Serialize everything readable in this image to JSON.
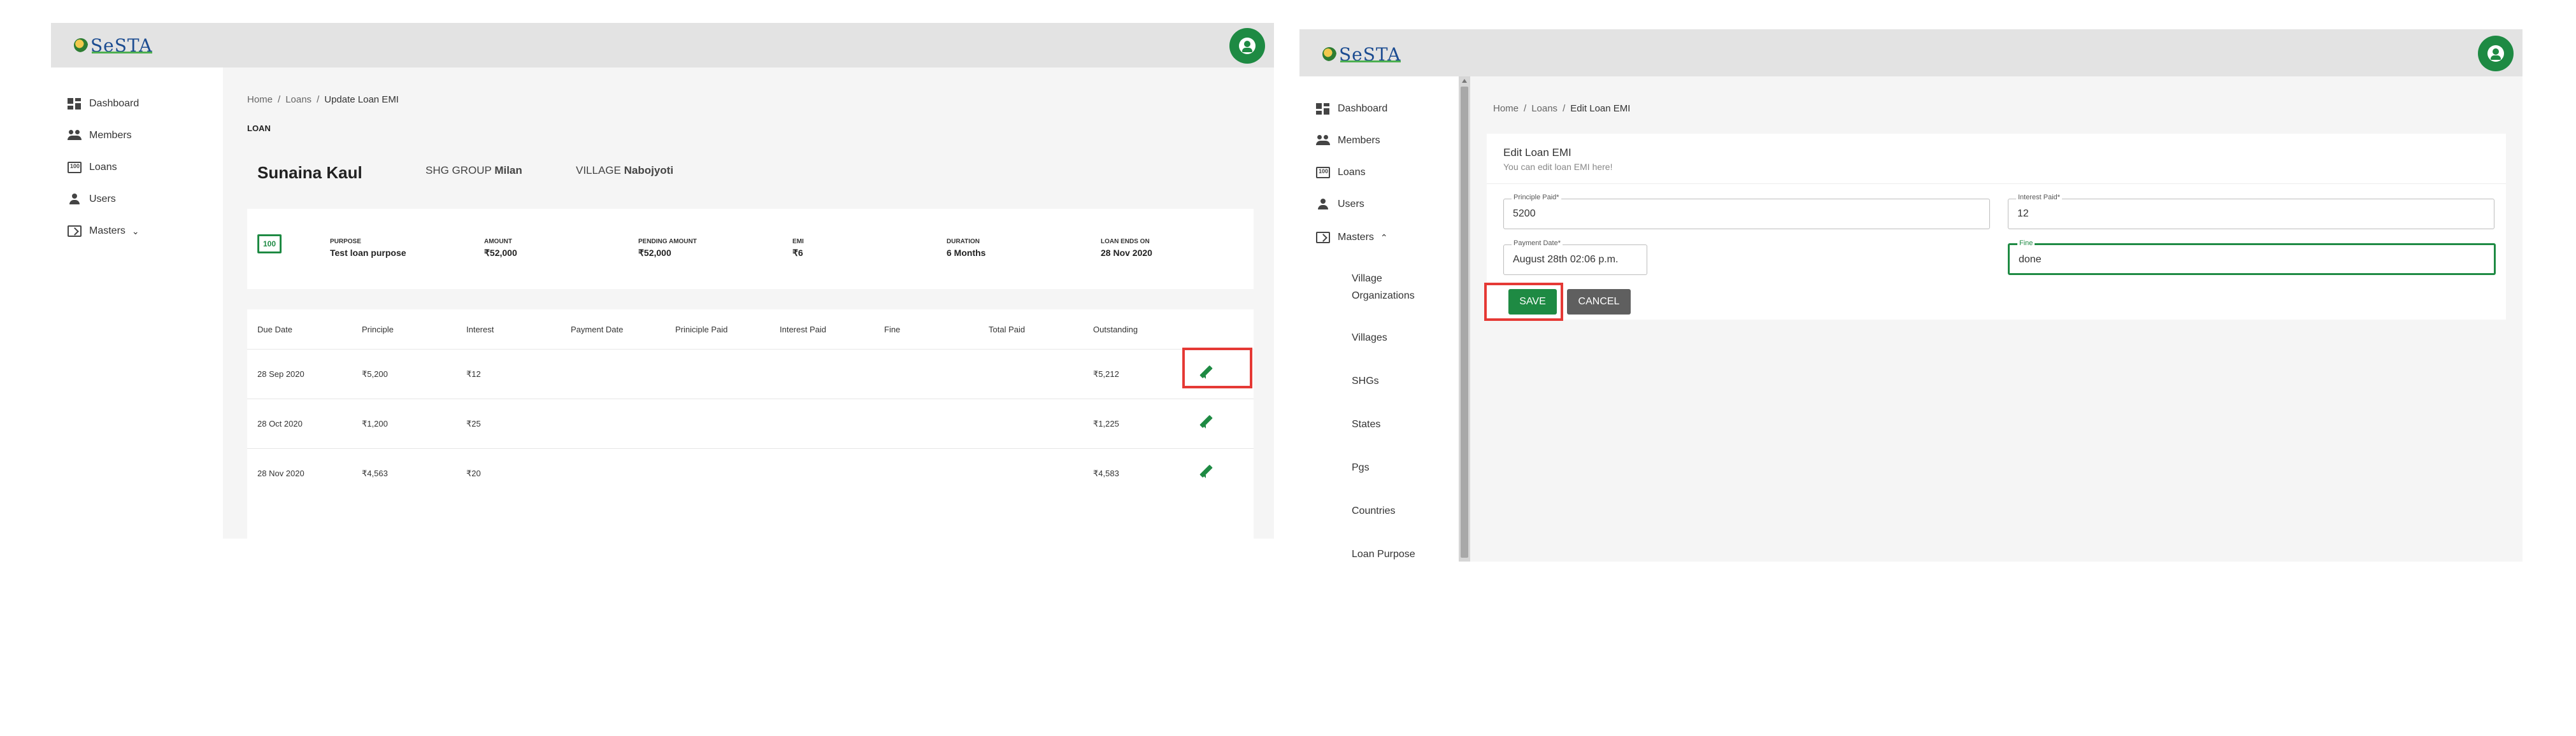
{
  "colors": {
    "brand_green": "#1e8a43",
    "highlight_red": "#e53935",
    "logo_blue": "#1c4c91"
  },
  "left": {
    "logo": "SeSTA",
    "sidebar": {
      "items": [
        {
          "label": "Dashboard",
          "icon": "dashboard-icon"
        },
        {
          "label": "Members",
          "icon": "people-icon"
        },
        {
          "label": "Loans",
          "icon": "loans-icon"
        },
        {
          "label": "Users",
          "icon": "user-icon"
        },
        {
          "label": "Masters",
          "icon": "masters-icon"
        }
      ]
    },
    "breadcrumb": {
      "home": "Home",
      "loans": "Loans",
      "current": "Update Loan EMI"
    },
    "section_title": "LOAN",
    "member": {
      "name": "Sunaina Kaul",
      "shg_label": "SHG GROUP",
      "shg_value": "Milan",
      "village_label": "VILLAGE",
      "village_value": "Nabojyoti"
    },
    "summary": {
      "icon_text": "100",
      "items": [
        {
          "label": "PURPOSE",
          "value": "Test loan purpose"
        },
        {
          "label": "AMOUNT",
          "value": "₹52,000"
        },
        {
          "label": "PENDING AMOUNT",
          "value": "₹52,000"
        },
        {
          "label": "EMI",
          "value": "₹6"
        },
        {
          "label": "DURATION",
          "value": "6 Months"
        },
        {
          "label": "LOAN ENDS ON",
          "value": "28 Nov 2020"
        }
      ]
    },
    "table": {
      "headers": [
        "Due Date",
        "Principle",
        "Interest",
        "Payment Date",
        "Priniciple Paid",
        "Interest Paid",
        "Fine",
        "Total Paid",
        "Outstanding"
      ],
      "rows": [
        [
          "28 Sep 2020",
          "₹5,200",
          "₹12",
          "",
          "",
          "",
          "",
          "",
          "₹5,212"
        ],
        [
          "28 Oct 2020",
          "₹1,200",
          "₹25",
          "",
          "",
          "",
          "",
          "",
          "₹1,225"
        ],
        [
          "28 Nov 2020",
          "₹4,563",
          "₹20",
          "",
          "",
          "",
          "",
          "",
          "₹4,583"
        ]
      ]
    }
  },
  "right": {
    "logo": "SeSTA",
    "sidebar": {
      "items": [
        {
          "label": "Dashboard",
          "icon": "dashboard-icon"
        },
        {
          "label": "Members",
          "icon": "people-icon"
        },
        {
          "label": "Loans",
          "icon": "loans-icon"
        },
        {
          "label": "Users",
          "icon": "user-icon"
        },
        {
          "label": "Masters",
          "icon": "masters-icon"
        }
      ],
      "masters_sub": [
        {
          "label": "Village Organizations"
        },
        {
          "label": "Villages"
        },
        {
          "label": "SHGs"
        },
        {
          "label": "States"
        },
        {
          "label": "Pgs"
        },
        {
          "label": "Countries"
        },
        {
          "label": "Loan Purpose"
        }
      ]
    },
    "breadcrumb": {
      "home": "Home",
      "loans": "Loans",
      "current": "Edit Loan EMI"
    },
    "form": {
      "title": "Edit Loan EMI",
      "subtitle": "You can edit loan EMI here!",
      "principle_paid": {
        "label": "Principle Paid*",
        "value": "5200"
      },
      "interest_paid": {
        "label": "Interest Paid*",
        "value": "12"
      },
      "payment_date": {
        "label": "Payment Date*",
        "value": "August 28th 02:06 p.m."
      },
      "fine": {
        "label": "Fine",
        "value": "done"
      },
      "save_label": "SAVE",
      "cancel_label": "CANCEL"
    }
  }
}
